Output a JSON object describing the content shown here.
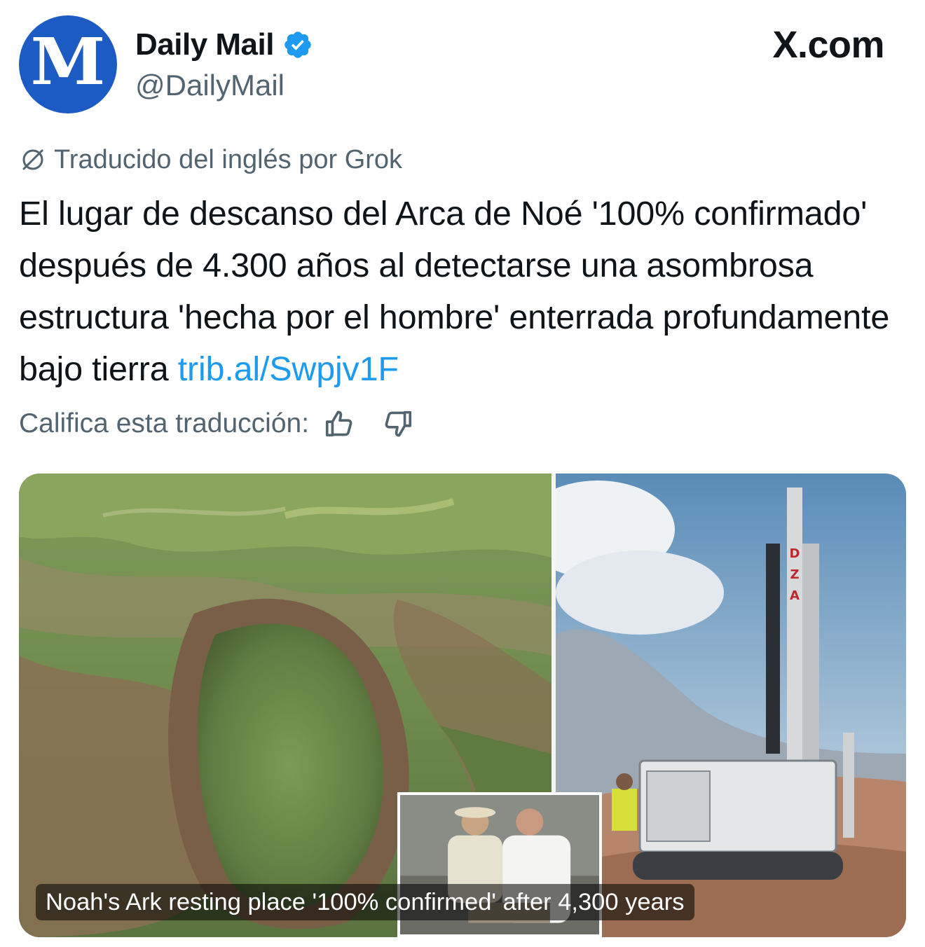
{
  "author": {
    "avatar_letter": "M",
    "display_name": "Daily Mail",
    "handle": "@DailyMail",
    "verified": true,
    "brand_color": "#1d5bc4"
  },
  "site_label": "X.com",
  "translation": {
    "label": "Traducido del inglés por Grok",
    "rate_label": "Califica esta traducción:"
  },
  "tweet": {
    "text": "El lugar de descanso del Arca de Noé '100% confirmado' después de 4.300 años al detectarse una asombrosa estructura 'hecha por el hombre' enterrada profundamente bajo tierra ",
    "link_text": "trib.al/Swpjv1F",
    "link_color": "#1d9bf0"
  },
  "media": {
    "caption": "Noah's Ark resting place '100% confirmed' after 4,300 years",
    "rig_label": "DZA"
  },
  "icons": {
    "verified": "verified-badge-icon",
    "translate": "grok-icon",
    "like": "thumbs-up-icon",
    "dislike": "thumbs-down-icon"
  }
}
